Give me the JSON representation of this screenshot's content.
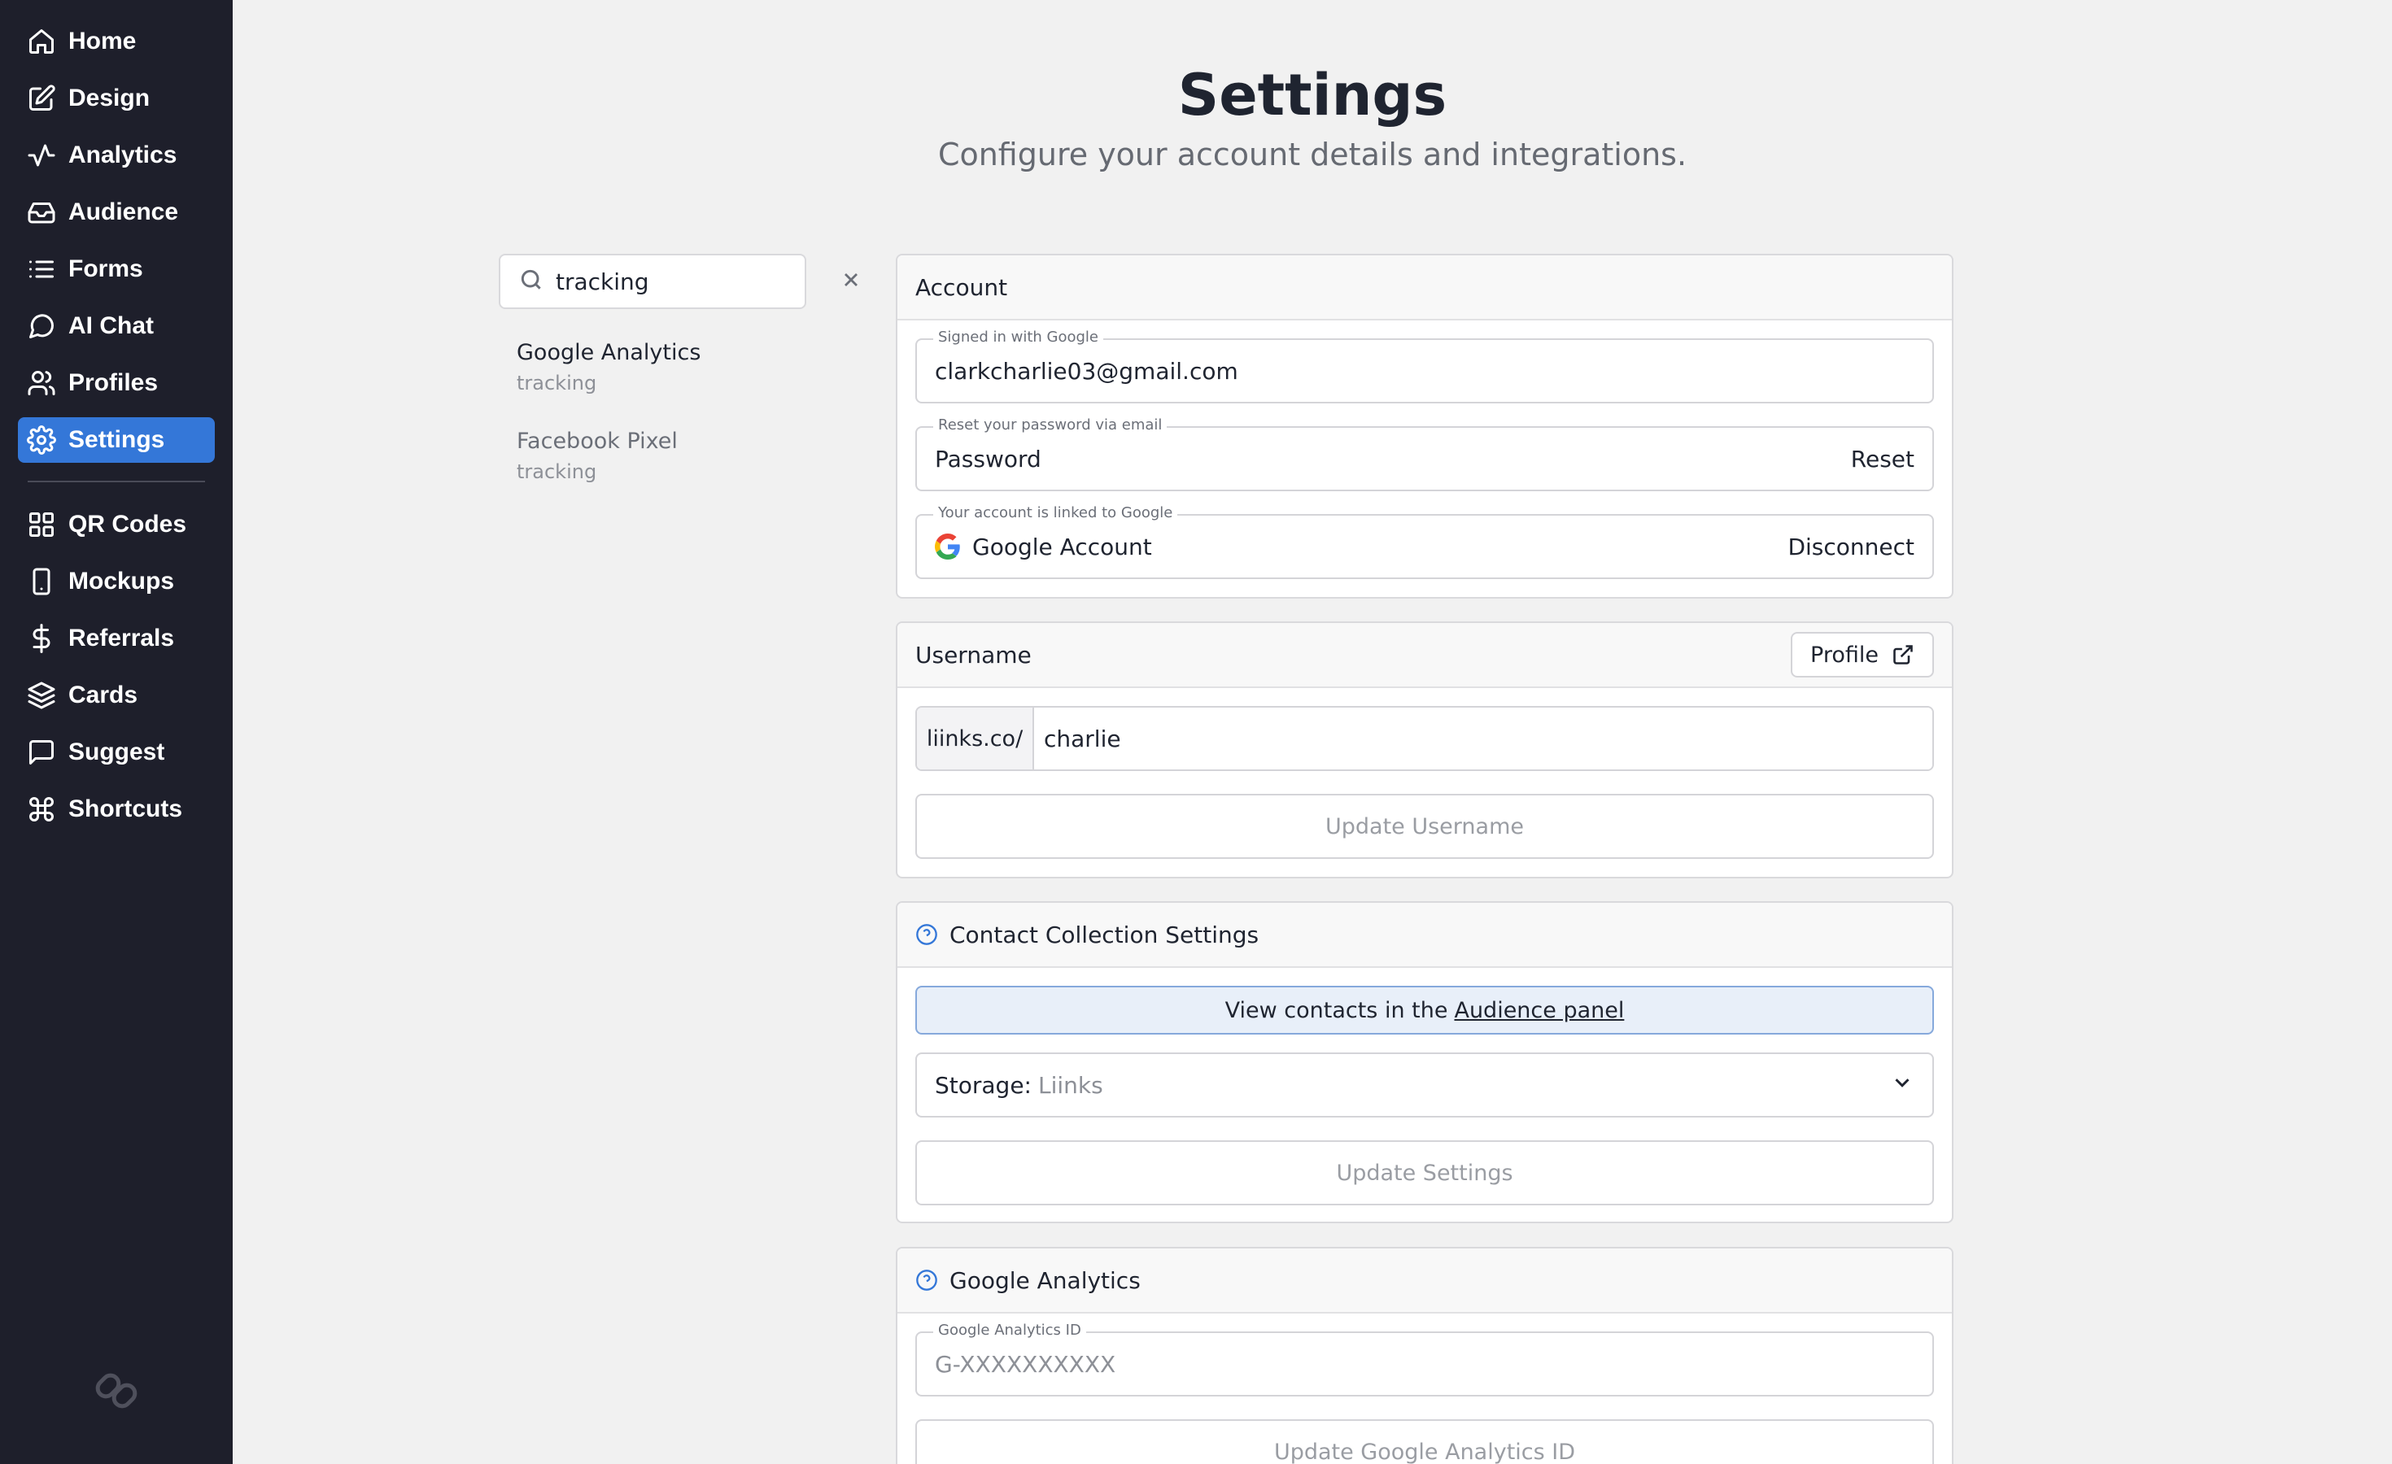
{
  "sidebar": {
    "items": [
      {
        "label": "Home",
        "icon": "home-icon"
      },
      {
        "label": "Design",
        "icon": "edit-icon"
      },
      {
        "label": "Analytics",
        "icon": "activity-icon"
      },
      {
        "label": "Audience",
        "icon": "inbox-icon"
      },
      {
        "label": "Forms",
        "icon": "list-icon"
      },
      {
        "label": "AI Chat",
        "icon": "chat-bubble-icon"
      },
      {
        "label": "Profiles",
        "icon": "users-icon"
      },
      {
        "label": "Settings",
        "icon": "gear-icon",
        "active": true
      },
      {
        "label": "QR Codes",
        "icon": "grid-icon"
      },
      {
        "label": "Mockups",
        "icon": "phone-icon"
      },
      {
        "label": "Referrals",
        "icon": "dollar-icon"
      },
      {
        "label": "Cards",
        "icon": "layers-icon"
      },
      {
        "label": "Suggest",
        "icon": "message-square-icon"
      },
      {
        "label": "Shortcuts",
        "icon": "command-icon"
      }
    ],
    "logo_icon": "link-logo-icon"
  },
  "header": {
    "title": "Settings",
    "subtitle": "Configure your account details and integrations."
  },
  "search": {
    "value": "tracking",
    "results": [
      {
        "title": "Google Analytics",
        "tag": "tracking"
      },
      {
        "title": "Facebook Pixel",
        "tag": "tracking"
      }
    ]
  },
  "account": {
    "title": "Account",
    "email_legend": "Signed in with Google",
    "email": "clarkcharlie03@gmail.com",
    "password_legend": "Reset your password via email",
    "password_label": "Password",
    "reset_label": "Reset",
    "google_legend": "Your account is linked to Google",
    "google_label": "Google Account",
    "disconnect_label": "Disconnect"
  },
  "username": {
    "title": "Username",
    "profile_button": "Profile",
    "prefix": "liinks.co/",
    "value": "charlie",
    "update_button": "Update Username"
  },
  "contact": {
    "title": "Contact Collection Settings",
    "banner_text": "View contacts in the",
    "banner_link": "Audience panel",
    "storage_label": "Storage:",
    "storage_value": "Liinks",
    "update_button": "Update Settings"
  },
  "google_analytics": {
    "title": "Google Analytics",
    "id_legend": "Google Analytics ID",
    "id_placeholder": "G-XXXXXXXXXX",
    "update_button": "Update Google Analytics ID"
  },
  "colors": {
    "sidebar_bg": "#1e1f2b",
    "accent": "#3477d8",
    "page_bg": "#f1f1f1"
  }
}
